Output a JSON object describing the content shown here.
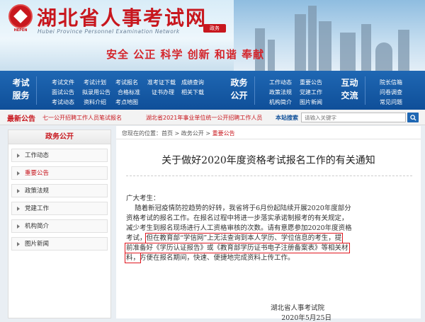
{
  "header": {
    "title": "湖北省人事考试网",
    "subtitle": "Hubei Province Personnel Examination Network",
    "gov_badge": "政务",
    "slogan": "安全 公正 科学 创新 和谐 奉献",
    "logo_text": "HEPEN"
  },
  "nav": {
    "groups": [
      {
        "title_line1": "考试",
        "title_line2": "服务",
        "links": [
          "考试文件",
          "考试计划",
          "考试报名",
          "准考证下载",
          "成绩查询",
          "面试公告",
          "拟录用公告",
          "合格标准",
          "证书办理",
          "相关下载",
          "考试动态",
          "资料介绍",
          "考点地图"
        ]
      },
      {
        "title_line1": "政务",
        "title_line2": "公开",
        "links": [
          "工作动态",
          "重要公告",
          "政策法规",
          "党建工作",
          "机构简介",
          "图片新闻"
        ]
      },
      {
        "title_line1": "互动",
        "title_line2": "交流",
        "links": [
          "院长信箱",
          "问卷调查",
          "常见问题"
        ]
      }
    ]
  },
  "searchbar": {
    "label": "最新公告",
    "marquee": [
      "七一公开招聘工作人员笔试报名",
      "湖北省2021年事业单位统一公开招聘工作人员笔试"
    ],
    "site_search": "本站搜索",
    "placeholder": "请输入关键字"
  },
  "sidebar": {
    "title": "政务公开",
    "items": [
      "工作动态",
      "重要公告",
      "政策法规",
      "党建工作",
      "机构简介",
      "图片新闻"
    ],
    "active_index": 1
  },
  "breadcrumb": {
    "prefix": "您现在的位置：",
    "home": "首页",
    "sep": " > ",
    "section": "政务公开",
    "current": "重要公告"
  },
  "article": {
    "title": "关于做好2020年度资格考试报名工作的有关通知",
    "salutation": "广大考生：",
    "lines": [
      "    随着新冠疫情防控趋势的好转，我省将于6月份起陆续开展2020年度部分",
      "资格考试的报名工作。在报名过程中将进一步落实承诺制报考的有关规定，",
      "减少考生到报名现场进行人工资格审核的次数。请有意愿参加2020年度资格"
    ],
    "line4_pre": "考试，",
    "line4_hl": "但在教育部“学信网”上无法查询到本人学历、学位信息的考生，提",
    "line5_hl": "前准备好《学历认证报告》或《教育部学历证书电子注册备案表》等相关材",
    "line6_hl": "料，",
    "line6_post": "方便在报名期间，快速、便捷地完成资料上传工作。",
    "signature": "湖北省人事考试院",
    "date": "2020年5月25日"
  },
  "colors": {
    "brand_red": "#c8171e",
    "nav_blue": "#1f67b3",
    "highlight": "#e0161e"
  }
}
